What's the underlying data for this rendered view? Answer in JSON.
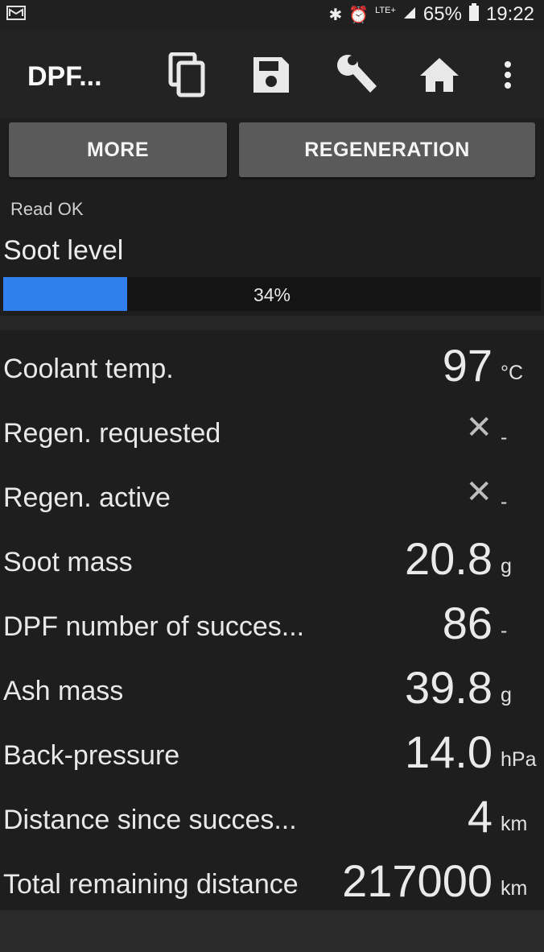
{
  "status_bar": {
    "battery": "65%",
    "time": "19:22",
    "network": "LTE+"
  },
  "toolbar": {
    "title": "DPF...",
    "icons": [
      "copy-icon",
      "save-icon",
      "wrench-icon",
      "home-icon",
      "more-vert-icon"
    ]
  },
  "buttons": {
    "more": "MORE",
    "regeneration": "REGENERATION"
  },
  "status_text": "Read OK",
  "soot": {
    "label": "Soot level",
    "percent_text": "34%",
    "fraction": 0.34
  },
  "rows": [
    {
      "label": "Coolant temp.",
      "value": "97",
      "unit": "°C"
    },
    {
      "label": "Regen. requested",
      "value": "✕",
      "unit": "-"
    },
    {
      "label": "Regen. active",
      "value": "✕",
      "unit": "-"
    },
    {
      "label": "Soot mass",
      "value": "20.8",
      "unit": "g"
    },
    {
      "label": "DPF number of succes...",
      "value": "86",
      "unit": "-"
    },
    {
      "label": "Ash mass",
      "value": "39.8",
      "unit": "g"
    },
    {
      "label": "Back-pressure",
      "value": "14.0",
      "unit": "hPa"
    },
    {
      "label": "Distance since succes...",
      "value": "4",
      "unit": "km"
    },
    {
      "label": "Total remaining distance",
      "value": "217000",
      "unit": "km"
    }
  ]
}
